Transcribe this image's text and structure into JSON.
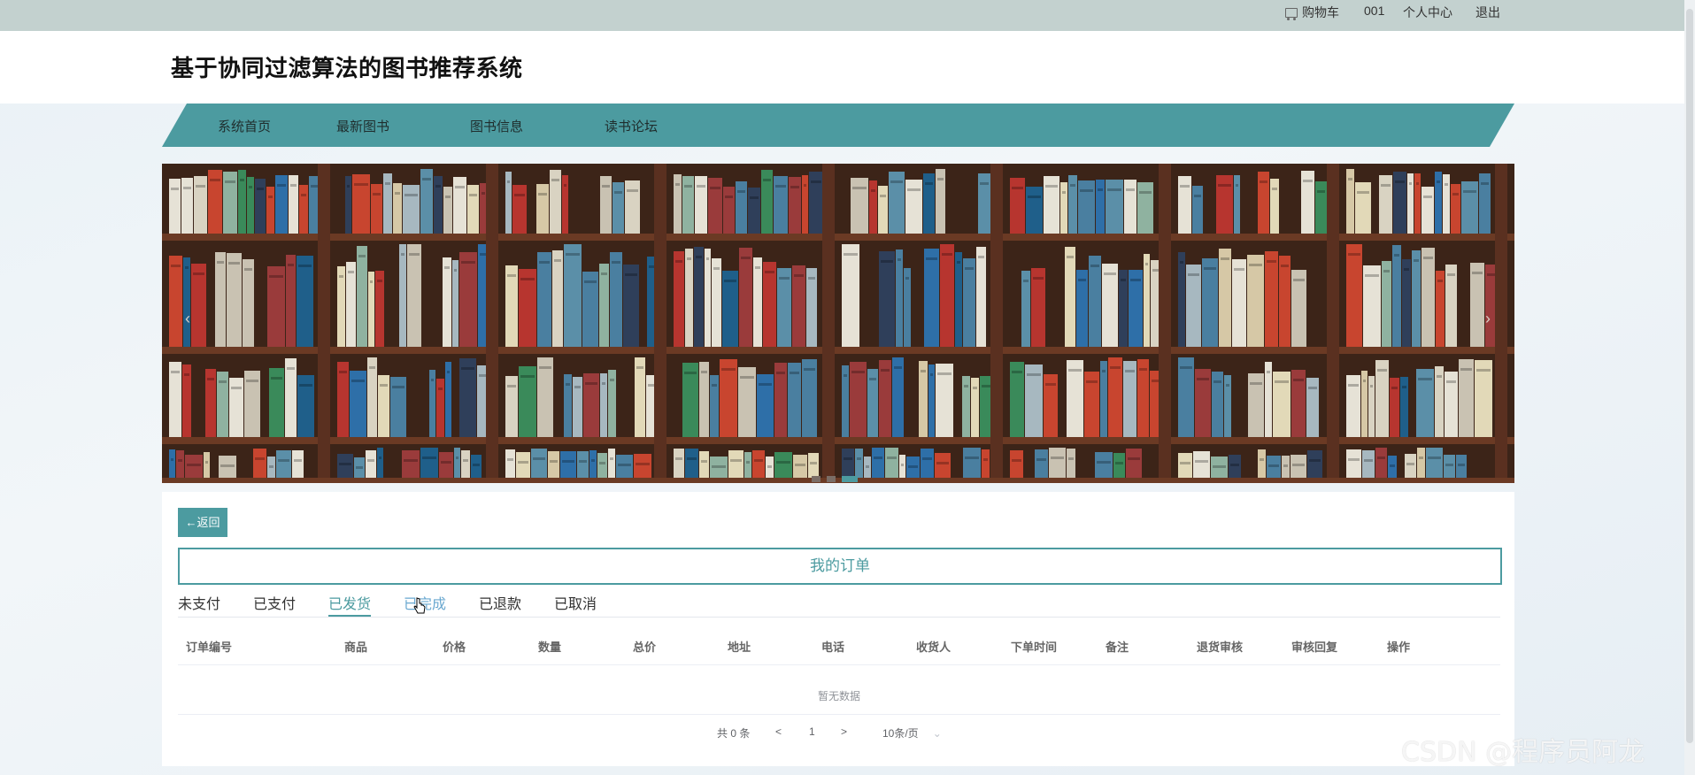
{
  "topbar": {
    "cart_label": "购物车",
    "user_name": "001",
    "profile_label": "个人中心",
    "logout_label": "退出"
  },
  "header": {
    "title": "基于协同过滤算法的图书推荐系统"
  },
  "nav": {
    "items": [
      "系统首页",
      "最新图书",
      "图书信息",
      "读书论坛"
    ]
  },
  "banner": {
    "prev": "‹",
    "next": "›"
  },
  "orders": {
    "back_label": "←返回",
    "title": "我的订单",
    "tabs": [
      "未支付",
      "已支付",
      "已发货",
      "已完成",
      "已退款",
      "已取消"
    ],
    "active_tab": "已发货",
    "columns": [
      "订单编号",
      "商品",
      "价格",
      "数量",
      "总价",
      "地址",
      "电话",
      "收货人",
      "下单时间",
      "备注",
      "退货审核",
      "审核回复",
      "操作"
    ],
    "empty_text": "暂无数据"
  },
  "pagination": {
    "total": "共 0 条",
    "prev": "<",
    "page": "1",
    "next": ">",
    "page_size": "10条/页"
  },
  "watermark": "CSDN @程序员阿龙",
  "colors": {
    "accent": "#4c9ba0",
    "topbar": "#c3d1cf"
  }
}
